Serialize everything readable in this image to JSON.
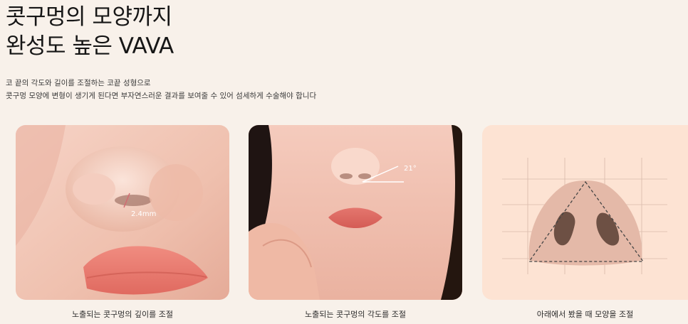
{
  "headline": {
    "line1": "콧구멍의 모양까지",
    "line2": "완성도 높은 VAVA"
  },
  "description": {
    "line1": "코 끝의 각도와 길이를 조절하는 코끝 성형으로",
    "line2": "콧구멍 모양에 변형이 생기게 된다면 부자연스러운 결과를 보여줄 수 있어 섬세하게 수술해야 합니다"
  },
  "cards": [
    {
      "measure": "2.4mm",
      "caption": "노출되는 콧구멍의 깊이를 조절"
    },
    {
      "measure": "21°",
      "caption": "노출되는 콧구멍의 각도를 조절"
    },
    {
      "caption": "아래에서 봤을 때 모양을 조절"
    }
  ],
  "colors": {
    "background": "#f8f1ea",
    "skin": "#f2c9b9",
    "lips": "#e8736a",
    "diagram_bg": "#fde3d3",
    "nostril": "#6d5044"
  }
}
